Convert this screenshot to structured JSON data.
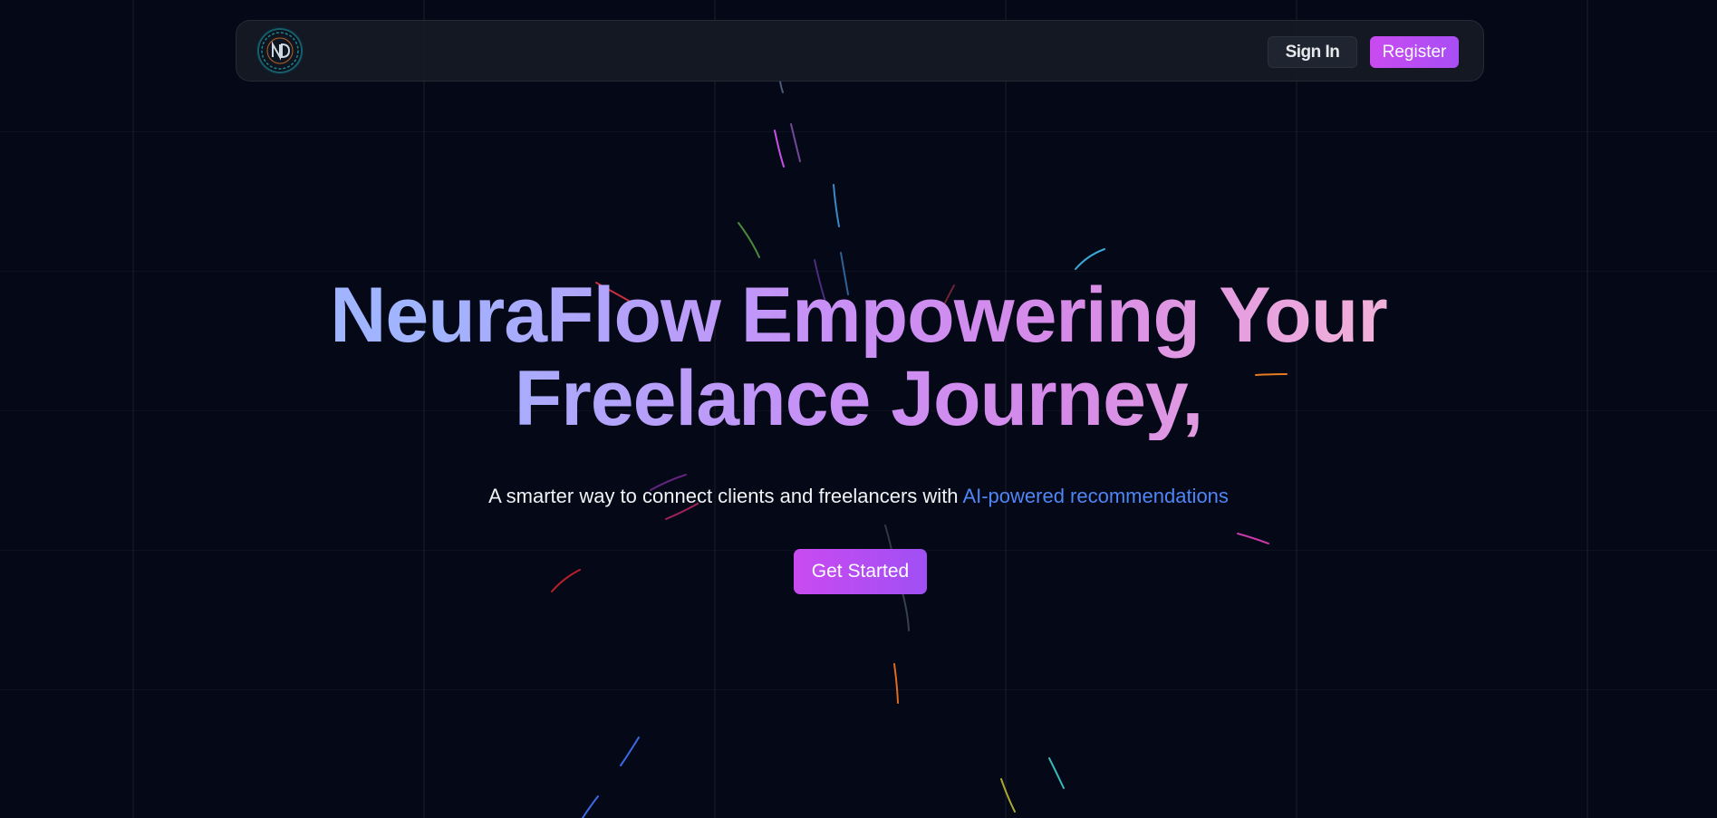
{
  "navbar": {
    "logo_icon": "neuraflow-logo-icon",
    "signin_label": "Sign In",
    "register_label": "Register"
  },
  "hero": {
    "headline_line1": "NeuraFlow Empowering Your",
    "headline_line2": "Freelance Journey,",
    "subtitle_text": "A smarter way to connect clients and freelancers with ",
    "subtitle_accent": "AI-powered recommendations",
    "cta_label": "Get Started"
  },
  "colors": {
    "background": "#050816",
    "navbar_bg": "#161b26",
    "button_gradient_start": "#c94bf0",
    "button_gradient_end": "#a84ef4",
    "accent_link": "#4e86f5",
    "headline_gradient": [
      "#a0b4ff",
      "#c890f6",
      "#d68ae8",
      "#f4b4d8"
    ]
  }
}
